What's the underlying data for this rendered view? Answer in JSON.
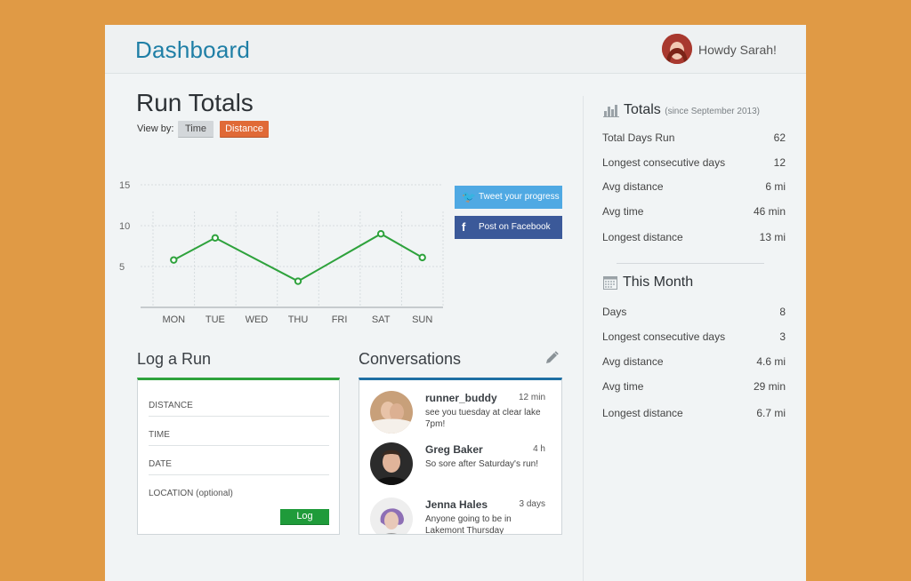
{
  "header": {
    "title": "Dashboard",
    "greeting": "Howdy Sarah!"
  },
  "run_totals": {
    "title": "Run Totals",
    "view_by_label": "View by:",
    "options": [
      "Time",
      "Distance"
    ],
    "selected": "Distance"
  },
  "chart_data": {
    "type": "line",
    "categories": [
      "MON",
      "TUE",
      "WED",
      "THU",
      "FRI",
      "SAT",
      "SUN"
    ],
    "series": [
      {
        "values": [
          5.8,
          8.5,
          null,
          3.2,
          null,
          9.0,
          6.1
        ]
      }
    ],
    "y_ticks": [
      "5",
      "10",
      "15"
    ],
    "ylim": [
      0,
      15
    ],
    "grid": true,
    "line_color": "#2ea23c"
  },
  "social": {
    "tweet_label": "Tweet your progress",
    "facebook_label": "Post on Facebook"
  },
  "log_run": {
    "title": "Log a Run",
    "fields": [
      "DISTANCE",
      "TIME",
      "DATE",
      "LOCATION (optional)"
    ],
    "button_label": "Log"
  },
  "conversations": {
    "title": "Conversations",
    "items": [
      {
        "name": "runner_buddy",
        "time": "12 min",
        "message": "see you tuesday at clear lake 7pm!"
      },
      {
        "name": "Greg Baker",
        "time": "4 h",
        "message": "So sore after Saturday's run!"
      },
      {
        "name": "Jenna Hales",
        "time": "3 days",
        "message": "Anyone going to be in Lakemont Thursday"
      }
    ]
  },
  "totals": {
    "title": "Totals",
    "subtitle": "(since September 2013)",
    "rows": [
      {
        "label": "Total Days Run",
        "value": "62"
      },
      {
        "label": "Longest consecutive days",
        "value": "12"
      },
      {
        "label": "Avg distance",
        "value": "6 mi"
      },
      {
        "label": "Avg time",
        "value": "46 min"
      },
      {
        "label": "Longest distance",
        "value": "13 mi"
      }
    ]
  },
  "this_month": {
    "title": "This Month",
    "rows": [
      {
        "label": "Days",
        "value": "8"
      },
      {
        "label": "Longest consecutive days",
        "value": "3"
      },
      {
        "label": "Avg distance",
        "value": "4.6 mi"
      },
      {
        "label": "Avg time",
        "value": "29 min"
      },
      {
        "label": "Longest distance",
        "value": "6.7 mi"
      }
    ]
  },
  "colors": {
    "accent_blue": "#1f7fa6",
    "accent_orange": "#e06a37",
    "accent_green": "#2ea23c",
    "background": "#e09a45"
  }
}
